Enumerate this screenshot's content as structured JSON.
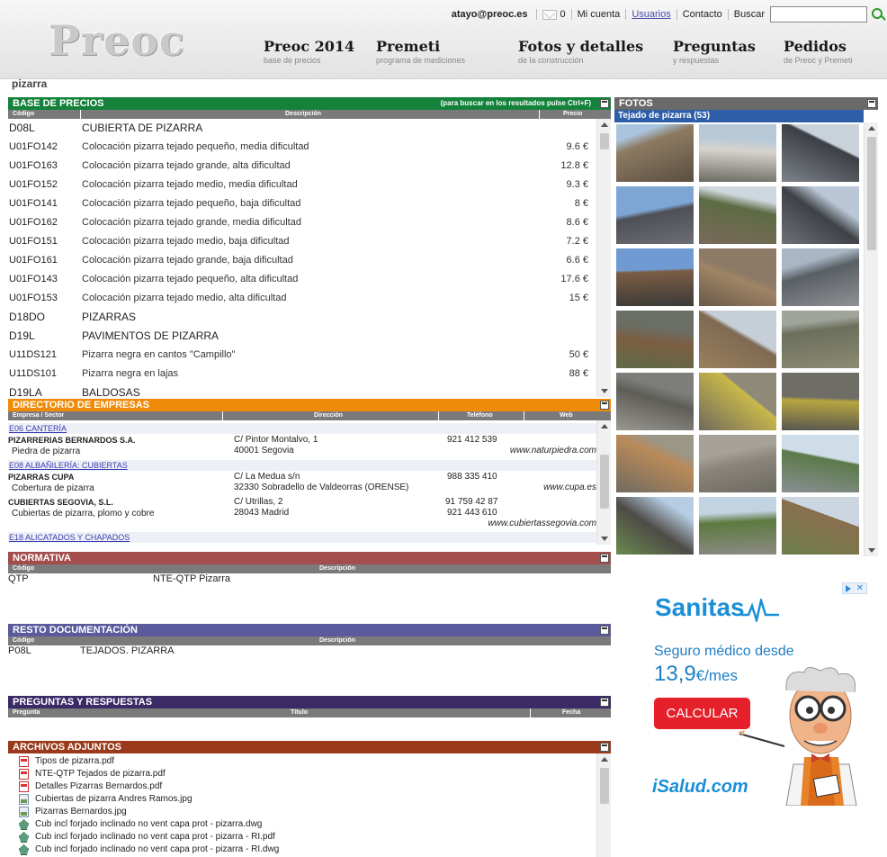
{
  "header": {
    "logo": "Preoc",
    "user": "atayo@preoc.es",
    "messages_count": "0",
    "links": [
      "Mi cuenta",
      "Usuarios",
      "Contacto"
    ],
    "search_label": "Buscar",
    "search_value": "",
    "nav": [
      {
        "title": "Preoc 2014",
        "subtitle": "base de precios"
      },
      {
        "title": "Premeti",
        "subtitle": "programa de mediciones"
      },
      {
        "title": "Fotos y detalles",
        "subtitle": "de la construcción"
      },
      {
        "title": "Preguntas",
        "subtitle": "y respuestas"
      },
      {
        "title": "Pedidos",
        "subtitle": "de Preoc y Premeti"
      }
    ]
  },
  "page_tag": "pizarra",
  "base_precios": {
    "title": "BASE DE PRECIOS",
    "note": "(para buscar en los resultados pulse Ctrl+F)",
    "col_code": "Código",
    "col_desc": "Descripción",
    "col_price": "Precio",
    "rows": [
      {
        "code": "D08L",
        "desc": "CUBIERTA DE PIZARRA",
        "price": "",
        "cat": true
      },
      {
        "code": "U01FO142",
        "desc": "Colocación pizarra tejado pequeño, media dificultad",
        "price": "9.6 €",
        "cat": false
      },
      {
        "code": "U01FO163",
        "desc": "Colocación pizarra tejado grande, alta dificultad",
        "price": "12.8 €",
        "cat": false
      },
      {
        "code": "U01FO152",
        "desc": "Colocación pizarra tejado medio, media dificultad",
        "price": "9.3 €",
        "cat": false
      },
      {
        "code": "U01FO141",
        "desc": "Colocación pizarra tejado pequeño, baja dificultad",
        "price": "8 €",
        "cat": false
      },
      {
        "code": "U01FO162",
        "desc": "Colocación pizarra tejado grande, media dificultad",
        "price": "8.6 €",
        "cat": false
      },
      {
        "code": "U01FO151",
        "desc": "Colocación pizarra tejado medio, baja dificultad",
        "price": "7.2 €",
        "cat": false
      },
      {
        "code": "U01FO161",
        "desc": "Colocación pizarra tejado grande, baja dificultad",
        "price": "6.6 €",
        "cat": false
      },
      {
        "code": "U01FO143",
        "desc": "Colocación pizarra tejado pequeño, alta dificultad",
        "price": "17.6 €",
        "cat": false
      },
      {
        "code": "U01FO153",
        "desc": "Colocación pizarra tejado medio, alta dificultad",
        "price": "15 €",
        "cat": false
      },
      {
        "code": "D18DO",
        "desc": "PIZARRAS",
        "price": "",
        "cat": true
      },
      {
        "code": "D19L",
        "desc": "PAVIMENTOS DE PIZARRA",
        "price": "",
        "cat": true
      },
      {
        "code": "U11DS121",
        "desc": "Pizarra negra en cantos \"Campillo\"",
        "price": "50 €",
        "cat": false
      },
      {
        "code": "U11DS101",
        "desc": "Pizarra negra en lajas",
        "price": "88 €",
        "cat": false
      },
      {
        "code": "D19LA",
        "desc": "BALDOSAS",
        "price": "",
        "cat": true
      }
    ]
  },
  "directorio": {
    "title": "DIRECTORIO DE EMPRESAS",
    "col_company": "Empresa / Sector",
    "col_address": "Dirección",
    "col_phone": "Teléfono",
    "col_web": "Web",
    "sections": [
      {
        "label": "E06  CANTERÍA",
        "companies": [
          {
            "name": "PIZARRERIAS BERNARDOS S.A.",
            "sector": "Piedra de pizarra",
            "address": [
              "C/ Pintor Montalvo, 1",
              "40001 Segovia"
            ],
            "phones": [
              "921 412 539"
            ],
            "web": "www.naturpiedra.com"
          }
        ]
      },
      {
        "label": "E08  ALBAÑILERÍA: CUBIERTAS",
        "companies": [
          {
            "name": "PIZARRAS CUPA",
            "sector": "Cobertura de pizarra",
            "address": [
              "C/ La Medua s/n",
              "32330 Sobradello de Valdeorras (ORENSE)"
            ],
            "phones": [
              "988 335 410"
            ],
            "web": "www.cupa.es"
          },
          {
            "name": "CUBIERTAS SEGOVIA, S.L.",
            "sector": "Cubiertas de pizarra, plomo y cobre",
            "address": [
              "C/ Utrillas, 2",
              "28043 Madrid"
            ],
            "phones": [
              "91 759 42 87",
              "921 443 610"
            ],
            "web": "www.cubiertassegovia.com"
          }
        ]
      },
      {
        "label": "E18  ALICATADOS Y CHAPADOS",
        "companies": []
      }
    ]
  },
  "normativa": {
    "title": "NORMATIVA",
    "col_code": "Código",
    "col_desc": "Descripción",
    "rows": [
      {
        "code": "QTP",
        "desc": "NTE-QTP Pizarra"
      }
    ]
  },
  "resto": {
    "title": "RESTO DOCUMENTACIÓN",
    "col_code": "Código",
    "col_desc": "Descripción",
    "rows": [
      {
        "code": "P08L",
        "desc": "TEJADOS. PIZARRA"
      }
    ]
  },
  "preguntas": {
    "title": "PREGUNTAS Y RESPUESTAS",
    "col_q": "Pregunta",
    "col_t": "Título",
    "col_d": "Fecha"
  },
  "archivos": {
    "title": "ARCHIVOS ADJUNTOS",
    "files": [
      {
        "name": "Tipos de pizarra.pdf",
        "type": "pdf"
      },
      {
        "name": "NTE-QTP Tejados de pizarra.pdf",
        "type": "pdf"
      },
      {
        "name": "Detalles Pizarras Bernardos.pdf",
        "type": "pdf"
      },
      {
        "name": "Cubiertas de pizarra Andres Ramos.jpg",
        "type": "jpg"
      },
      {
        "name": "Pizarras Bernardos.jpg",
        "type": "jpg"
      },
      {
        "name": "Cub incl forjado inclinado no vent capa prot - pizarra.dwg",
        "type": "dwg"
      },
      {
        "name": "Cub incl forjado inclinado no vent capa prot - pizarra - RI.pdf",
        "type": "dwg"
      },
      {
        "name": "Cub incl forjado inclinado no vent capa prot - pizarra - RI.dwg",
        "type": "dwg"
      }
    ]
  },
  "fotos": {
    "title": "FOTOS",
    "album": "Tejado de pizarra (53)",
    "palettes": [
      [
        "#a9c4dc",
        "#8d7a62",
        "#5a4e40"
      ],
      [
        "#b8c9d8",
        "#d7d3cc",
        "#6b6b63"
      ],
      [
        "#c9d2da",
        "#3c3f44",
        "#7d838a"
      ],
      [
        "#7ea6d4",
        "#4e5056",
        "#6b6e72"
      ],
      [
        "#cfd7de",
        "#5d6b44",
        "#7a6a5a"
      ],
      [
        "#b9c7d6",
        "#3e4145",
        "#6e7276"
      ],
      [
        "#6f9ad2",
        "#7b5d44",
        "#3c3a38"
      ],
      [
        "#8d7a66",
        "#a08466",
        "#6a5a48"
      ],
      [
        "#a9b7c5",
        "#5a5f64",
        "#8e9295"
      ],
      [
        "#6a6e64",
        "#7c5e42",
        "#5f6a48"
      ],
      [
        "#c6cfd8",
        "#7f6a52",
        "#9a7f5e"
      ],
      [
        "#a0a49a",
        "#6b6f5c",
        "#8c8a72"
      ],
      [
        "#7d7e7a",
        "#5e5d58",
        "#9a9891"
      ],
      [
        "#8f8a78",
        "#c9b84a",
        "#6f6a5c"
      ],
      [
        "#6e6d66",
        "#b8a640",
        "#57564f"
      ],
      [
        "#9c9686",
        "#b98a5a",
        "#6f6a5f"
      ],
      [
        "#a6a29a",
        "#8a857a",
        "#6d6a62"
      ],
      [
        "#cfdde8",
        "#5b7a4a",
        "#8a8f92"
      ],
      [
        "#b7cde3",
        "#4e4b47",
        "#6a8a4e"
      ],
      [
        "#c2d3e2",
        "#5c7a3e",
        "#8d8a86"
      ],
      [
        "#cbd6e0",
        "#8a6e4e",
        "#6d7f4a"
      ]
    ]
  },
  "ad": {
    "brand": "Sanitas",
    "line1": "Seguro médico desde",
    "price": "13,9",
    "unit": "€/mes",
    "cta": "CALCULAR",
    "footer": "iSalud.com"
  }
}
